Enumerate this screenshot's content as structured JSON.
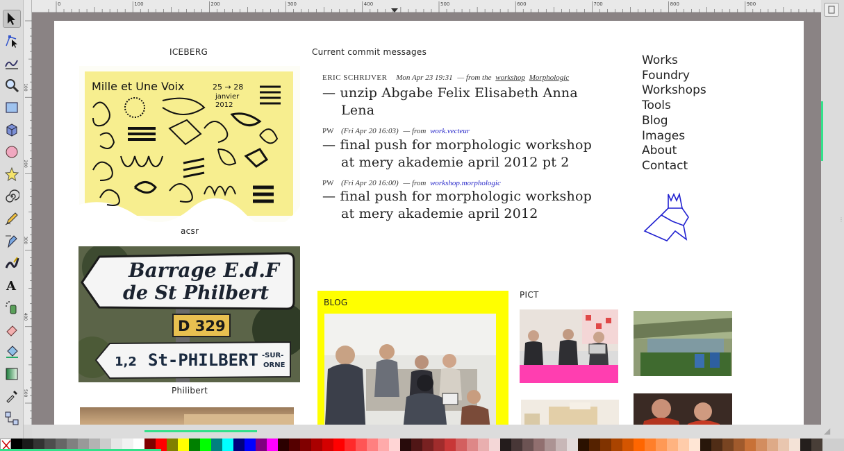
{
  "site": {
    "iceberg_label": "ICEBERG",
    "commits_label": "Current commit messages",
    "works": [
      {
        "caption": "acsr",
        "poster": {
          "title": "Mille et Une Voix",
          "dates": "25 → 28",
          "month": "janvier",
          "year": "2012"
        }
      },
      {
        "caption": "Philibert",
        "sign": {
          "line1": "Barrage E.d.F",
          "line2": "de St Philbert",
          "road": "D 329",
          "num": "1,2",
          "place": "St-PHILBERT",
          "sub1": "-SUR-",
          "sub2": "ORNE"
        }
      }
    ],
    "commits": [
      {
        "author": "ERIC SCHRIJVER",
        "date": "Mon Apr 23 19:31",
        "from_text": "— from the",
        "repo1": "workshop",
        "repo2": "Morphologic",
        "line1": "— unzip Abgabe Felix Elisabeth Anna",
        "line2": "Lena"
      },
      {
        "author": "PW",
        "date": "(Fri Apr 20 16:03)",
        "from_text": "— from",
        "repo1": "work.vecteur",
        "line1": "— final push for morphologic workshop",
        "line2": "at mery akademie april 2012 pt 2"
      },
      {
        "author": "PW",
        "date": "(Fri Apr 20 16:00)",
        "from_text": "— from",
        "repo1": "workshop.morphologic",
        "line1": "— final push for morphologic workshop",
        "line2": "at mery akademie april 2012"
      }
    ],
    "nav": [
      "Works",
      "Foundry",
      "Workshops",
      "Tools",
      "Blog",
      "Images",
      "About",
      "Contact"
    ],
    "blog_label": "BLOG",
    "pict_label": "PICT"
  },
  "rulers": {
    "h_ticks": [
      "0",
      "100",
      "200",
      "300",
      "400",
      "500",
      "600",
      "700",
      "800",
      "900"
    ],
    "v_ticks": [
      "100",
      "200",
      "300",
      "400",
      "500"
    ]
  },
  "tools": [
    "selector-icon",
    "node-icon",
    "tweak-icon",
    "zoom-icon",
    "rect-icon",
    "box3d-icon",
    "ellipse-icon",
    "star-icon",
    "spiral-icon",
    "pencil-icon",
    "pen-icon",
    "calligraphy-icon",
    "text-icon",
    "spray-icon",
    "eraser-icon",
    "bucket-icon",
    "gradient-icon",
    "dropper-icon",
    "connector-icon"
  ],
  "colors": {
    "accent_yellow": "#ffff00",
    "link_blue": "#2525c8",
    "poster_yellow": "#f7ee8f",
    "scroll_green": "#34e08a"
  },
  "palette": [
    "#000000",
    "#1a1a1a",
    "#333333",
    "#4d4d4d",
    "#666666",
    "#808080",
    "#999999",
    "#b3b3b3",
    "#cccccc",
    "#e6e6e6",
    "#f2f2f2",
    "#ffffff",
    "#800000",
    "#ff0000",
    "#808000",
    "#ffff00",
    "#008000",
    "#00ff00",
    "#008080",
    "#00ffff",
    "#000080",
    "#0000ff",
    "#800080",
    "#ff00ff",
    "#2b0000",
    "#550000",
    "#800000",
    "#aa0000",
    "#d40000",
    "#ff0000",
    "#ff2a2a",
    "#ff5555",
    "#ff8080",
    "#ffaaaa",
    "#ffd5d5",
    "#280b0b",
    "#501616",
    "#782121",
    "#a02c2c",
    "#c83737",
    "#d35f5f",
    "#de8787",
    "#e9afaf",
    "#f4d7d7",
    "#241c1c",
    "#483737",
    "#6c5353",
    "#916f6f",
    "#ac9393",
    "#c8b7b7",
    "#e3dbdb",
    "#2b1100",
    "#552200",
    "#803300",
    "#aa4400",
    "#d45500",
    "#ff6600",
    "#ff7f2a",
    "#ff9955",
    "#ffb380",
    "#ffccaa",
    "#ffe6d5",
    "#28170b",
    "#502d16",
    "#784421",
    "#a05a2c",
    "#c87137",
    "#d38d5f",
    "#deaa87",
    "#e9c6af",
    "#f4e3d7",
    "#241f1c",
    "#483e37"
  ]
}
